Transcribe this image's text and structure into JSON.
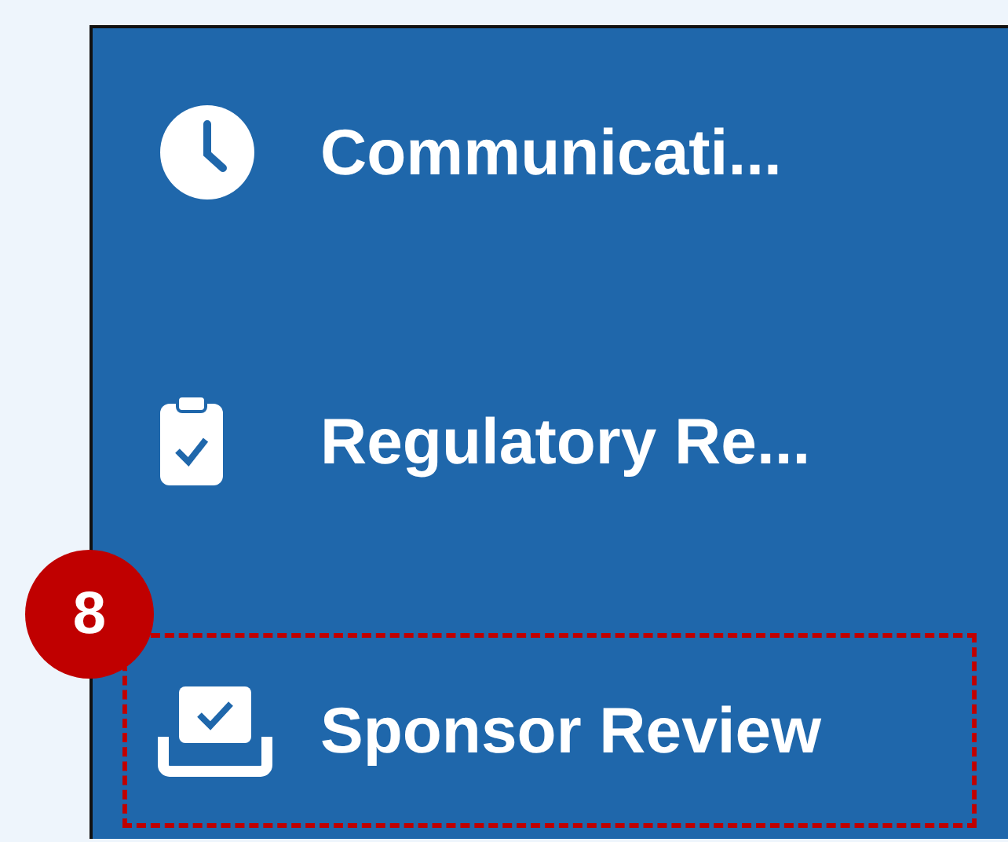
{
  "sidebar": {
    "items": [
      {
        "label": "Communicati...",
        "kind": "clock",
        "highlighted": false
      },
      {
        "label": "Regulatory Re...",
        "kind": "clipboard",
        "highlighted": false
      },
      {
        "label": "Sponsor Review",
        "kind": "tray",
        "highlighted": true,
        "callout": "8"
      }
    ]
  }
}
